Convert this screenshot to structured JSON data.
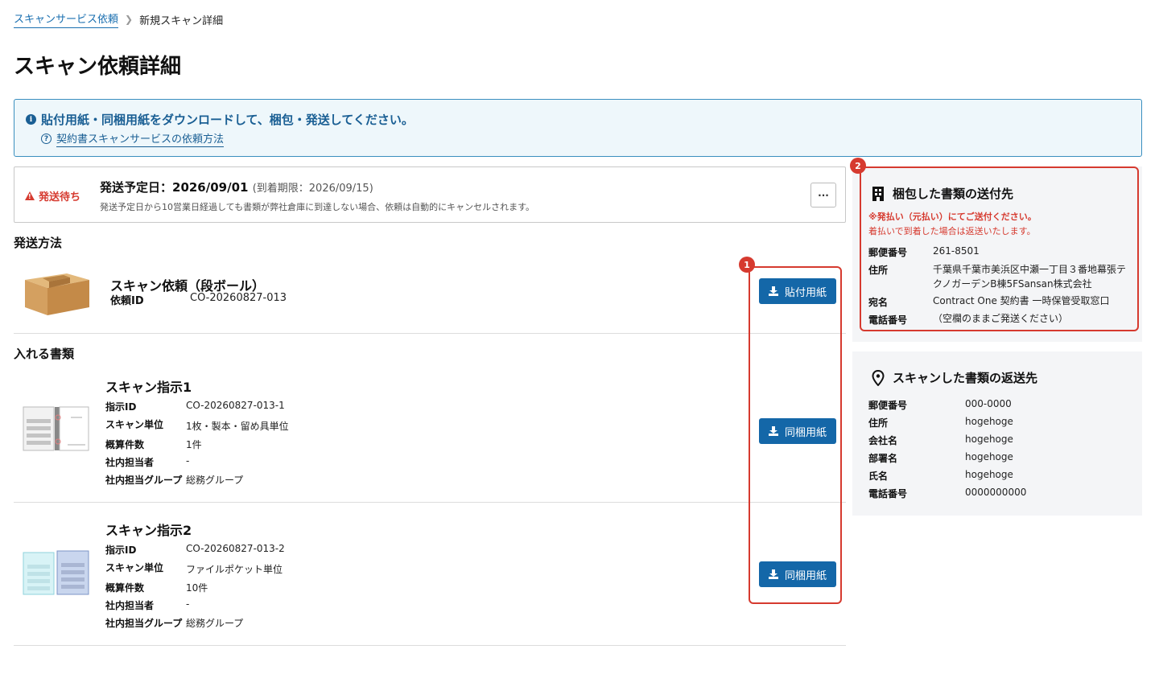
{
  "breadcrumb": {
    "parent": "スキャンサービス依頼",
    "current": "新規スキャン詳細"
  },
  "page_title": "スキャン依頼詳細",
  "info_banner": {
    "message": "貼付用紙・同梱用紙をダウンロードして、梱包・発送してください。",
    "help_link": "契約書スキャンサービスの依頼方法"
  },
  "status": {
    "badge": "発送待ち",
    "title": "発送予定日：2026/09/01",
    "deadline": "(到着期限：2026/09/15)",
    "note": "発送予定日から10営業日経過しても書類が弊社倉庫に到達しない場合、依頼は自動的にキャンセルされます。",
    "more_label": "···"
  },
  "shipping": {
    "heading": "発送方法",
    "name": "スキャン依頼（段ボール）",
    "id_label": "依頼ID",
    "id_value": "CO-20260827-013",
    "button_label": "貼付用紙"
  },
  "documents": {
    "heading": "入れる書類",
    "labels": {
      "id": "指示ID",
      "unit": "スキャン単位",
      "count": "概算件数",
      "owner": "社内担当者",
      "group": "社内担当グループ"
    },
    "button_label": "同梱用紙",
    "items": [
      {
        "title": "スキャン指示1",
        "id": "CO-20260827-013-1",
        "unit": "1枚・製本・留め具単位",
        "count": "1件",
        "owner": "-",
        "group": "総務グループ"
      },
      {
        "title": "スキャン指示2",
        "id": "CO-20260827-013-2",
        "unit": "ファイルポケット単位",
        "count": "10件",
        "owner": "-",
        "group": "総務グループ"
      }
    ]
  },
  "annotations": {
    "one": "1",
    "two": "2"
  },
  "destination": {
    "title": "梱包した書類の送付先",
    "warn1": "※発払い（元払い）にてご送付ください。",
    "warn2": "着払いで到着した場合は返送いたします。",
    "rows": [
      {
        "label": "郵便番号",
        "value": "261-8501"
      },
      {
        "label": "住所",
        "value": "千葉県千葉市美浜区中瀬一丁目３番地幕張テ",
        "value2": "クノガーデンB棟5FSansan株式会社"
      },
      {
        "label": "宛名",
        "value": "Contract One 契約書 一時保管受取窓口"
      },
      {
        "label": "電話番号",
        "value": "（空欄のままご発送ください）"
      }
    ]
  },
  "return": {
    "title": "スキャンした書類の返送先",
    "rows": [
      {
        "label": "郵便番号",
        "value": "000-0000"
      },
      {
        "label": "住所",
        "value": "hogehoge"
      },
      {
        "label": "会社名",
        "value": "hogehoge"
      },
      {
        "label": "部署名",
        "value": "hogehoge"
      },
      {
        "label": "氏名",
        "value": "hogehoge"
      },
      {
        "label": "電話番号",
        "value": "0000000000"
      }
    ]
  },
  "colors": {
    "primary": "#1467a8",
    "alert": "#d63a2f",
    "info_bg": "#eef7fb",
    "panel_bg": "#f4f5f7"
  }
}
